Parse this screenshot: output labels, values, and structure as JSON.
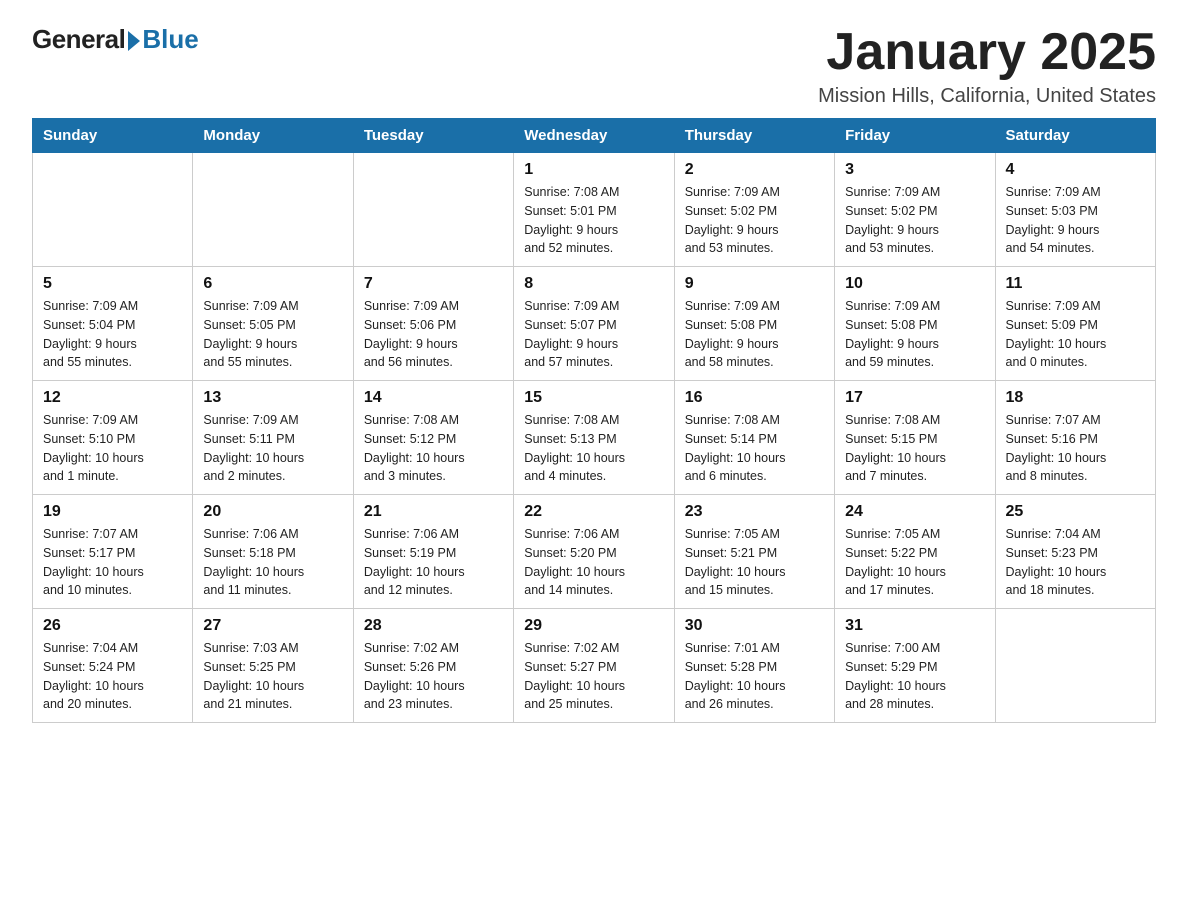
{
  "logo": {
    "general": "General",
    "blue": "Blue"
  },
  "title": "January 2025",
  "subtitle": "Mission Hills, California, United States",
  "days_of_week": [
    "Sunday",
    "Monday",
    "Tuesday",
    "Wednesday",
    "Thursday",
    "Friday",
    "Saturday"
  ],
  "weeks": [
    [
      {
        "day": "",
        "info": ""
      },
      {
        "day": "",
        "info": ""
      },
      {
        "day": "",
        "info": ""
      },
      {
        "day": "1",
        "info": "Sunrise: 7:08 AM\nSunset: 5:01 PM\nDaylight: 9 hours\nand 52 minutes."
      },
      {
        "day": "2",
        "info": "Sunrise: 7:09 AM\nSunset: 5:02 PM\nDaylight: 9 hours\nand 53 minutes."
      },
      {
        "day": "3",
        "info": "Sunrise: 7:09 AM\nSunset: 5:02 PM\nDaylight: 9 hours\nand 53 minutes."
      },
      {
        "day": "4",
        "info": "Sunrise: 7:09 AM\nSunset: 5:03 PM\nDaylight: 9 hours\nand 54 minutes."
      }
    ],
    [
      {
        "day": "5",
        "info": "Sunrise: 7:09 AM\nSunset: 5:04 PM\nDaylight: 9 hours\nand 55 minutes."
      },
      {
        "day": "6",
        "info": "Sunrise: 7:09 AM\nSunset: 5:05 PM\nDaylight: 9 hours\nand 55 minutes."
      },
      {
        "day": "7",
        "info": "Sunrise: 7:09 AM\nSunset: 5:06 PM\nDaylight: 9 hours\nand 56 minutes."
      },
      {
        "day": "8",
        "info": "Sunrise: 7:09 AM\nSunset: 5:07 PM\nDaylight: 9 hours\nand 57 minutes."
      },
      {
        "day": "9",
        "info": "Sunrise: 7:09 AM\nSunset: 5:08 PM\nDaylight: 9 hours\nand 58 minutes."
      },
      {
        "day": "10",
        "info": "Sunrise: 7:09 AM\nSunset: 5:08 PM\nDaylight: 9 hours\nand 59 minutes."
      },
      {
        "day": "11",
        "info": "Sunrise: 7:09 AM\nSunset: 5:09 PM\nDaylight: 10 hours\nand 0 minutes."
      }
    ],
    [
      {
        "day": "12",
        "info": "Sunrise: 7:09 AM\nSunset: 5:10 PM\nDaylight: 10 hours\nand 1 minute."
      },
      {
        "day": "13",
        "info": "Sunrise: 7:09 AM\nSunset: 5:11 PM\nDaylight: 10 hours\nand 2 minutes."
      },
      {
        "day": "14",
        "info": "Sunrise: 7:08 AM\nSunset: 5:12 PM\nDaylight: 10 hours\nand 3 minutes."
      },
      {
        "day": "15",
        "info": "Sunrise: 7:08 AM\nSunset: 5:13 PM\nDaylight: 10 hours\nand 4 minutes."
      },
      {
        "day": "16",
        "info": "Sunrise: 7:08 AM\nSunset: 5:14 PM\nDaylight: 10 hours\nand 6 minutes."
      },
      {
        "day": "17",
        "info": "Sunrise: 7:08 AM\nSunset: 5:15 PM\nDaylight: 10 hours\nand 7 minutes."
      },
      {
        "day": "18",
        "info": "Sunrise: 7:07 AM\nSunset: 5:16 PM\nDaylight: 10 hours\nand 8 minutes."
      }
    ],
    [
      {
        "day": "19",
        "info": "Sunrise: 7:07 AM\nSunset: 5:17 PM\nDaylight: 10 hours\nand 10 minutes."
      },
      {
        "day": "20",
        "info": "Sunrise: 7:06 AM\nSunset: 5:18 PM\nDaylight: 10 hours\nand 11 minutes."
      },
      {
        "day": "21",
        "info": "Sunrise: 7:06 AM\nSunset: 5:19 PM\nDaylight: 10 hours\nand 12 minutes."
      },
      {
        "day": "22",
        "info": "Sunrise: 7:06 AM\nSunset: 5:20 PM\nDaylight: 10 hours\nand 14 minutes."
      },
      {
        "day": "23",
        "info": "Sunrise: 7:05 AM\nSunset: 5:21 PM\nDaylight: 10 hours\nand 15 minutes."
      },
      {
        "day": "24",
        "info": "Sunrise: 7:05 AM\nSunset: 5:22 PM\nDaylight: 10 hours\nand 17 minutes."
      },
      {
        "day": "25",
        "info": "Sunrise: 7:04 AM\nSunset: 5:23 PM\nDaylight: 10 hours\nand 18 minutes."
      }
    ],
    [
      {
        "day": "26",
        "info": "Sunrise: 7:04 AM\nSunset: 5:24 PM\nDaylight: 10 hours\nand 20 minutes."
      },
      {
        "day": "27",
        "info": "Sunrise: 7:03 AM\nSunset: 5:25 PM\nDaylight: 10 hours\nand 21 minutes."
      },
      {
        "day": "28",
        "info": "Sunrise: 7:02 AM\nSunset: 5:26 PM\nDaylight: 10 hours\nand 23 minutes."
      },
      {
        "day": "29",
        "info": "Sunrise: 7:02 AM\nSunset: 5:27 PM\nDaylight: 10 hours\nand 25 minutes."
      },
      {
        "day": "30",
        "info": "Sunrise: 7:01 AM\nSunset: 5:28 PM\nDaylight: 10 hours\nand 26 minutes."
      },
      {
        "day": "31",
        "info": "Sunrise: 7:00 AM\nSunset: 5:29 PM\nDaylight: 10 hours\nand 28 minutes."
      },
      {
        "day": "",
        "info": ""
      }
    ]
  ]
}
